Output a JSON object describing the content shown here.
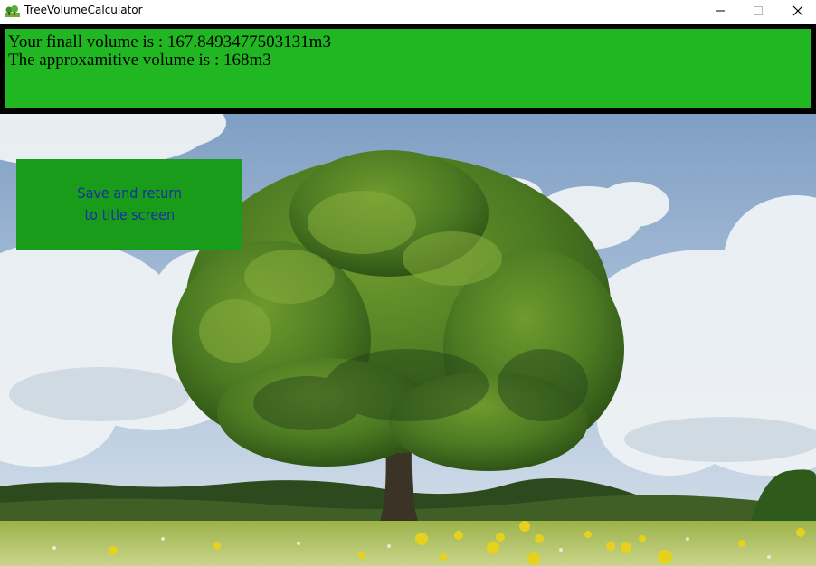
{
  "window": {
    "title": "TreeVolumeCalculator",
    "icon": "app-tree-icon",
    "controls": [
      "minimize-icon",
      "maximize-icon",
      "close-icon"
    ]
  },
  "result": {
    "line1": "Your finall volume is : 167.8493477503131m3",
    "line2": "The approxamitive volume is : 168m3"
  },
  "return_button": {
    "line1": "Save and return",
    "line2": "to title screen"
  },
  "colors": {
    "panel_green": "#21b722",
    "panel_border": "#000000",
    "button_green": "#189c1a",
    "button_text": "#1a2fa0"
  }
}
